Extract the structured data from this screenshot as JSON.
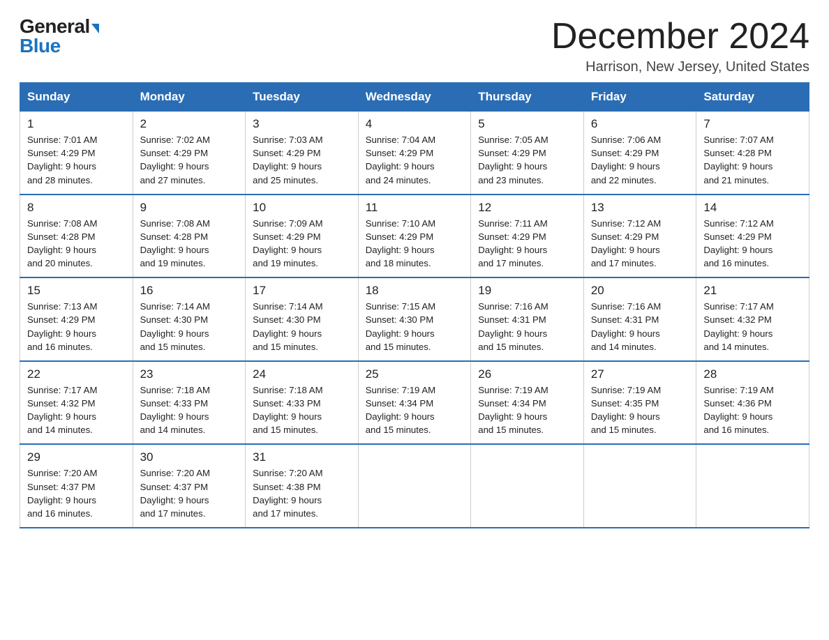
{
  "logo": {
    "general": "General",
    "blue": "Blue"
  },
  "title": "December 2024",
  "location": "Harrison, New Jersey, United States",
  "days_of_week": [
    "Sunday",
    "Monday",
    "Tuesday",
    "Wednesday",
    "Thursday",
    "Friday",
    "Saturday"
  ],
  "weeks": [
    [
      {
        "day": "1",
        "sunrise": "7:01 AM",
        "sunset": "4:29 PM",
        "daylight": "9 hours and 28 minutes."
      },
      {
        "day": "2",
        "sunrise": "7:02 AM",
        "sunset": "4:29 PM",
        "daylight": "9 hours and 27 minutes."
      },
      {
        "day": "3",
        "sunrise": "7:03 AM",
        "sunset": "4:29 PM",
        "daylight": "9 hours and 25 minutes."
      },
      {
        "day": "4",
        "sunrise": "7:04 AM",
        "sunset": "4:29 PM",
        "daylight": "9 hours and 24 minutes."
      },
      {
        "day": "5",
        "sunrise": "7:05 AM",
        "sunset": "4:29 PM",
        "daylight": "9 hours and 23 minutes."
      },
      {
        "day": "6",
        "sunrise": "7:06 AM",
        "sunset": "4:29 PM",
        "daylight": "9 hours and 22 minutes."
      },
      {
        "day": "7",
        "sunrise": "7:07 AM",
        "sunset": "4:28 PM",
        "daylight": "9 hours and 21 minutes."
      }
    ],
    [
      {
        "day": "8",
        "sunrise": "7:08 AM",
        "sunset": "4:28 PM",
        "daylight": "9 hours and 20 minutes."
      },
      {
        "day": "9",
        "sunrise": "7:08 AM",
        "sunset": "4:28 PM",
        "daylight": "9 hours and 19 minutes."
      },
      {
        "day": "10",
        "sunrise": "7:09 AM",
        "sunset": "4:29 PM",
        "daylight": "9 hours and 19 minutes."
      },
      {
        "day": "11",
        "sunrise": "7:10 AM",
        "sunset": "4:29 PM",
        "daylight": "9 hours and 18 minutes."
      },
      {
        "day": "12",
        "sunrise": "7:11 AM",
        "sunset": "4:29 PM",
        "daylight": "9 hours and 17 minutes."
      },
      {
        "day": "13",
        "sunrise": "7:12 AM",
        "sunset": "4:29 PM",
        "daylight": "9 hours and 17 minutes."
      },
      {
        "day": "14",
        "sunrise": "7:12 AM",
        "sunset": "4:29 PM",
        "daylight": "9 hours and 16 minutes."
      }
    ],
    [
      {
        "day": "15",
        "sunrise": "7:13 AM",
        "sunset": "4:29 PM",
        "daylight": "9 hours and 16 minutes."
      },
      {
        "day": "16",
        "sunrise": "7:14 AM",
        "sunset": "4:30 PM",
        "daylight": "9 hours and 15 minutes."
      },
      {
        "day": "17",
        "sunrise": "7:14 AM",
        "sunset": "4:30 PM",
        "daylight": "9 hours and 15 minutes."
      },
      {
        "day": "18",
        "sunrise": "7:15 AM",
        "sunset": "4:30 PM",
        "daylight": "9 hours and 15 minutes."
      },
      {
        "day": "19",
        "sunrise": "7:16 AM",
        "sunset": "4:31 PM",
        "daylight": "9 hours and 15 minutes."
      },
      {
        "day": "20",
        "sunrise": "7:16 AM",
        "sunset": "4:31 PM",
        "daylight": "9 hours and 14 minutes."
      },
      {
        "day": "21",
        "sunrise": "7:17 AM",
        "sunset": "4:32 PM",
        "daylight": "9 hours and 14 minutes."
      }
    ],
    [
      {
        "day": "22",
        "sunrise": "7:17 AM",
        "sunset": "4:32 PM",
        "daylight": "9 hours and 14 minutes."
      },
      {
        "day": "23",
        "sunrise": "7:18 AM",
        "sunset": "4:33 PM",
        "daylight": "9 hours and 14 minutes."
      },
      {
        "day": "24",
        "sunrise": "7:18 AM",
        "sunset": "4:33 PM",
        "daylight": "9 hours and 15 minutes."
      },
      {
        "day": "25",
        "sunrise": "7:19 AM",
        "sunset": "4:34 PM",
        "daylight": "9 hours and 15 minutes."
      },
      {
        "day": "26",
        "sunrise": "7:19 AM",
        "sunset": "4:34 PM",
        "daylight": "9 hours and 15 minutes."
      },
      {
        "day": "27",
        "sunrise": "7:19 AM",
        "sunset": "4:35 PM",
        "daylight": "9 hours and 15 minutes."
      },
      {
        "day": "28",
        "sunrise": "7:19 AM",
        "sunset": "4:36 PM",
        "daylight": "9 hours and 16 minutes."
      }
    ],
    [
      {
        "day": "29",
        "sunrise": "7:20 AM",
        "sunset": "4:37 PM",
        "daylight": "9 hours and 16 minutes."
      },
      {
        "day": "30",
        "sunrise": "7:20 AM",
        "sunset": "4:37 PM",
        "daylight": "9 hours and 17 minutes."
      },
      {
        "day": "31",
        "sunrise": "7:20 AM",
        "sunset": "4:38 PM",
        "daylight": "9 hours and 17 minutes."
      },
      null,
      null,
      null,
      null
    ]
  ]
}
